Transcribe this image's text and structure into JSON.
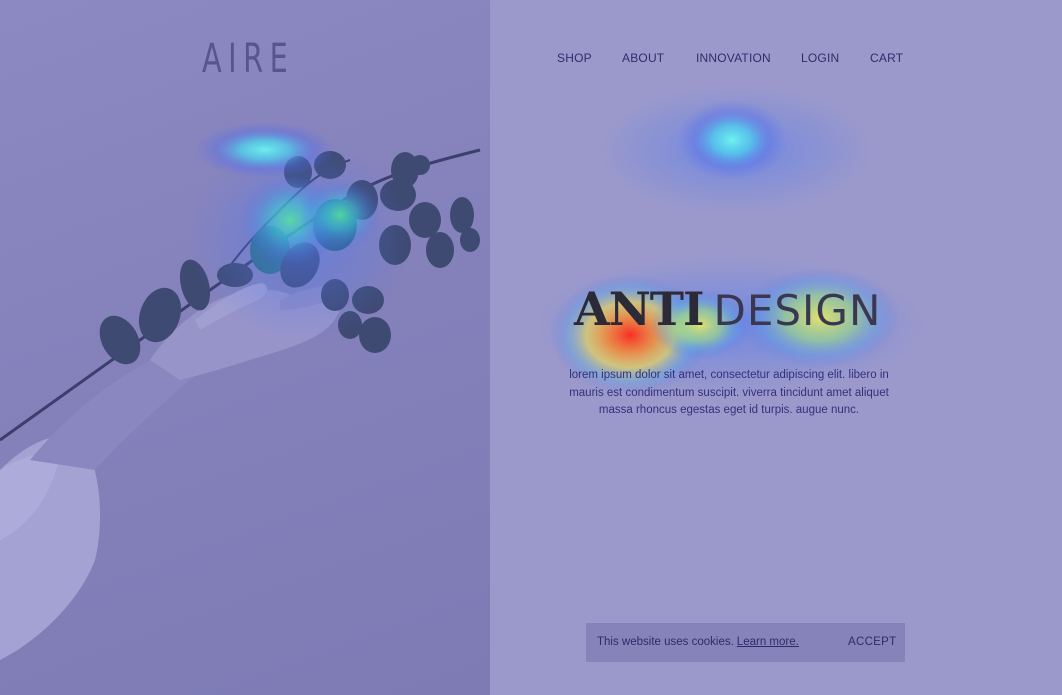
{
  "brand": {
    "logo": "AIRE"
  },
  "nav": {
    "shop": "SHOP",
    "about": "ABOUT",
    "innovation": "INNOVATION",
    "login": "LOGIN",
    "cart": "CART"
  },
  "hero": {
    "headline_bold": "ANTI",
    "headline_light": "DESIGN",
    "body_line1": "lorem ipsum dolor sit amet, consectetur adipiscing elit. libero in",
    "body_line2": "mauris est condimentum suscipit. viverra tincidunt amet aliquet",
    "body_line3": "massa rhoncus egestas eget id turpis. augue nunc."
  },
  "cookie": {
    "message": "This website uses cookies.",
    "link": "Learn more.",
    "accept": "ACCEPT"
  },
  "colors": {
    "overlay": "#9b99cb",
    "nav_text": "#2f2c6b",
    "heat_hot": "#ff3b1f",
    "heat_warm": "#f7e24a",
    "heat_cool": "#5cf2e6"
  }
}
